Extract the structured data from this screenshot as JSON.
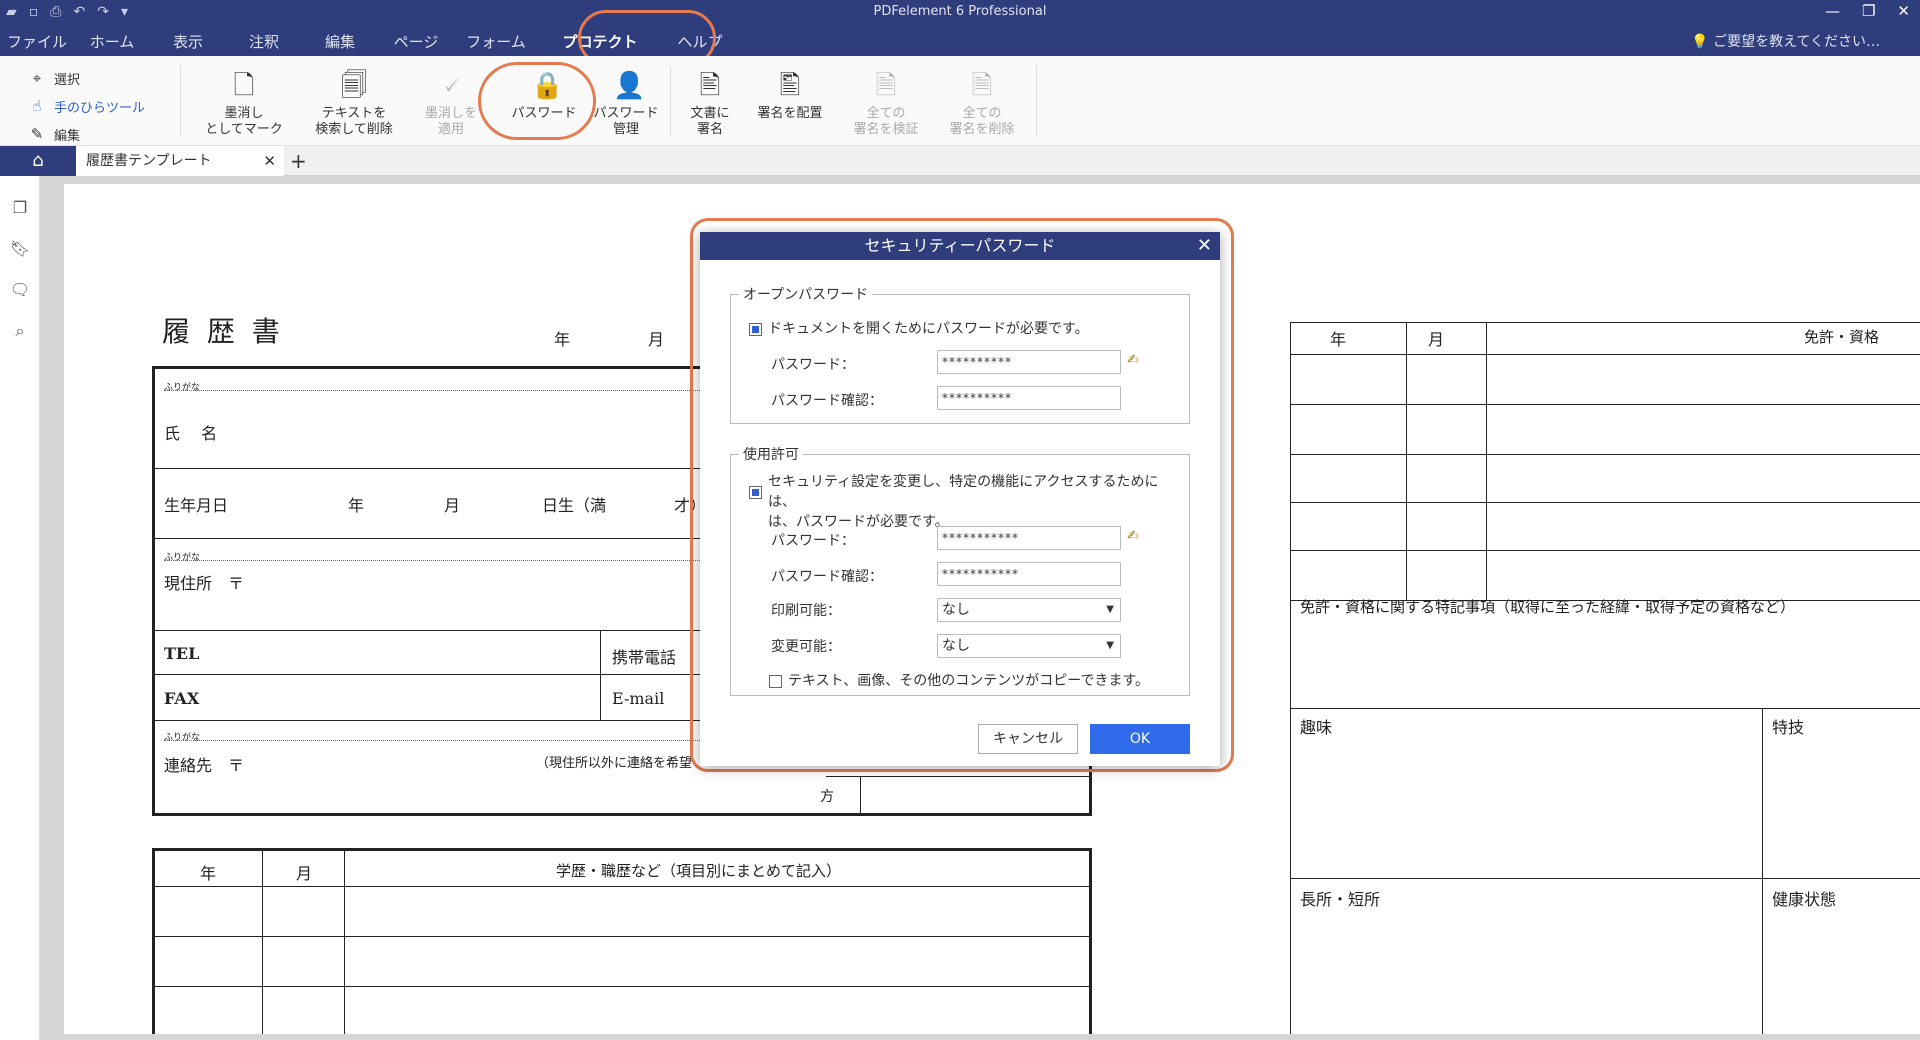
{
  "app": {
    "title": "PDFelement 6 Professional"
  },
  "menu": {
    "items": [
      "ファイル",
      "ホーム",
      "表示",
      "注釈",
      "編集",
      "ページ",
      "フォーム",
      "プロテクト",
      "ヘルプ"
    ],
    "active": "プロテクト",
    "help_hint": "ご要望を教えてください…"
  },
  "tools_left": {
    "select": "選択",
    "hand": "手のひらツール",
    "edit": "編集"
  },
  "ribbon": {
    "redact_mark": [
      "墨消し",
      "としてマーク"
    ],
    "search_redact": [
      "テキストを",
      "検索して削除"
    ],
    "apply_redact": [
      "墨消しを",
      "適用"
    ],
    "password": "パスワード",
    "password_manage": [
      "パスワード",
      "管理"
    ],
    "sign_doc": [
      "文書に",
      "署名"
    ],
    "place_sig": "署名を配置",
    "verify_all": [
      "全ての",
      "署名を検証"
    ],
    "delete_all": [
      "全ての",
      "署名を削除"
    ]
  },
  "tabs": {
    "doc_name": "履歴書テンプレート"
  },
  "resume": {
    "title": "履 歴 書",
    "year": "年",
    "month": "月",
    "furigana": "ふりがな",
    "name_label": "氏　 名",
    "birth": "生年月日",
    "birth_year": "年",
    "birth_month": "月",
    "birth_day": "日生（満",
    "birth_age": "才）",
    "address": "現住所　〒",
    "tel": "TEL",
    "mobile": "携帯電話",
    "fax": "FAX",
    "email": "E-mail",
    "contact": "連絡先　〒",
    "contact_note": "（現住所以外に連絡を希望",
    "kata": "方",
    "hist_year": "年",
    "hist_month": "月",
    "hist_header": "学歴・職歴など（項目別にまとめて記入）",
    "lic_year": "年",
    "lic_month": "月",
    "lic_header": "免許・資格",
    "lic_notes": "免許・資格に関する特記事項（取得に至った経緯・取得予定の資格など）",
    "hobby": "趣味",
    "skill": "特技",
    "strength": "長所・短所",
    "health": "健康状態"
  },
  "dialog": {
    "title": "セキュリティーパスワード",
    "open_group": "オープンパスワード",
    "open_require": "ドキュメントを開くためにパスワードが必要です。",
    "pw_label": "パスワード：",
    "pw_confirm_label": "パスワード確認：",
    "open_pw": "**********",
    "open_pw_confirm": "**********",
    "perm_group": "使用許可",
    "perm_require_1": "セキュリティ設定を変更し、特定の機能にアクセスするためには、",
    "perm_require_2": "は、パスワードが必要です。",
    "perm_pw": "***********",
    "perm_pw_confirm": "***********",
    "print_label": "印刷可能：",
    "print_value": "なし",
    "change_label": "変更可能：",
    "change_value": "なし",
    "copy_label": "テキスト、画像、その他のコンテンツがコピーできます。",
    "cancel": "キャンセル",
    "ok": "OK"
  },
  "colors": {
    "titlebar": "#2f3d7c",
    "accent": "#2f6bea",
    "highlight_ring": "#e57a4f"
  }
}
